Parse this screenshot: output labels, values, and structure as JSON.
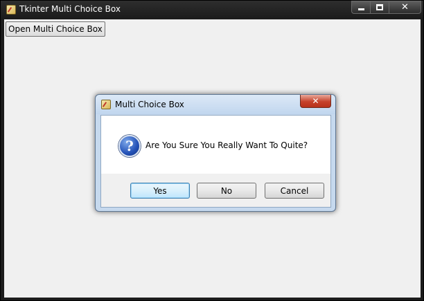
{
  "main_window": {
    "title": "Tkinter Multi Choice Box",
    "open_button_label": "Open Multi Choice Box",
    "controls": {
      "minimize": "minimize-icon",
      "maximize": "maximize-icon",
      "close_glyph": "✕"
    }
  },
  "dialog": {
    "title": "Multi Choice Box",
    "close_glyph": "✕",
    "message": "Are You Sure You Really Want To Quite?",
    "icon": "question-icon",
    "icon_glyph": "?",
    "buttons": {
      "yes": "Yes",
      "no": "No",
      "cancel": "Cancel"
    },
    "default_button": "yes"
  },
  "colors": {
    "client_bg": "#f0f0f0",
    "dialog_frame": "#c6d9ee",
    "close_red": "#c6412a",
    "default_button_border": "#3c7fb1"
  }
}
